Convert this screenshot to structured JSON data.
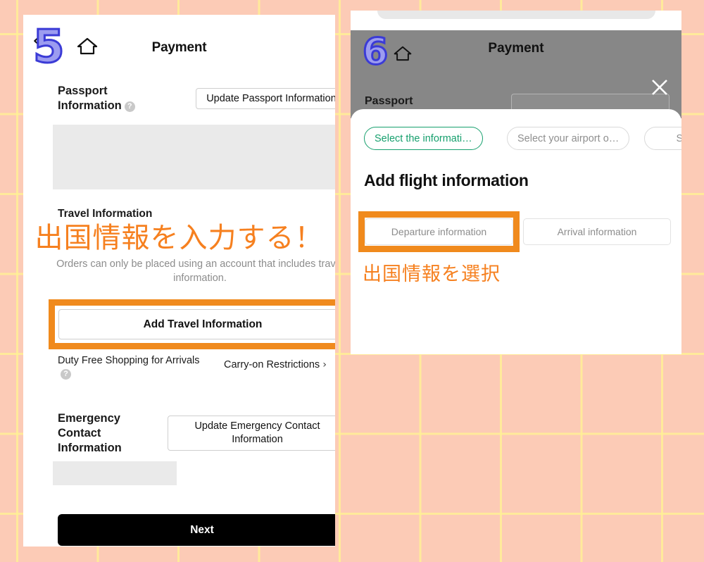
{
  "background": {
    "fill": "#fccbb6",
    "grid_line": "#fff0a0"
  },
  "left_panel": {
    "step_number": "5",
    "back_icon": "‹",
    "home_icon_name": "home-icon",
    "title": "Payment",
    "passport_section": {
      "label_line1": "Passport",
      "label_line2": "Information",
      "help_icon": "?",
      "button_label": "Update Passport Information"
    },
    "travel_section": {
      "heading": "Travel Information",
      "annotation_jp": "出国情報を入力する！",
      "note": "Orders can only be placed using an account that includes travel information.",
      "add_button_label": "Add Travel Information",
      "highlight_color": "#f08a1d"
    },
    "duty_free": {
      "label": "Duty Free Shopping for Arrivals",
      "help_icon": "?",
      "link_label": "Carry-on Restrictions",
      "chevron": "›"
    },
    "emergency_section": {
      "label_line1": "Emergency",
      "label_line2": "Contact",
      "label_line3": "Information",
      "button_label": "Update Emergency Contact Information"
    },
    "next_button_label": "Next"
  },
  "right_panel": {
    "step_number": "6",
    "home_icon_name": "home-icon",
    "title": "Payment",
    "close_icon_name": "close-icon",
    "dimmed_label": "Passport",
    "sheet": {
      "chips": [
        {
          "label": "Select the informati…",
          "state": "active"
        },
        {
          "label": "Select your airport o…",
          "state": "idle"
        },
        {
          "label": "Sele",
          "state": "idle"
        }
      ],
      "title": "Add flight information",
      "segments": [
        {
          "label": "Departure information",
          "highlighted": true
        },
        {
          "label": "Arrival information",
          "highlighted": false
        }
      ],
      "annotation_jp": "出国情報を選択",
      "highlight_color": "#f08a1d",
      "accent_color": "#17a06e"
    }
  }
}
